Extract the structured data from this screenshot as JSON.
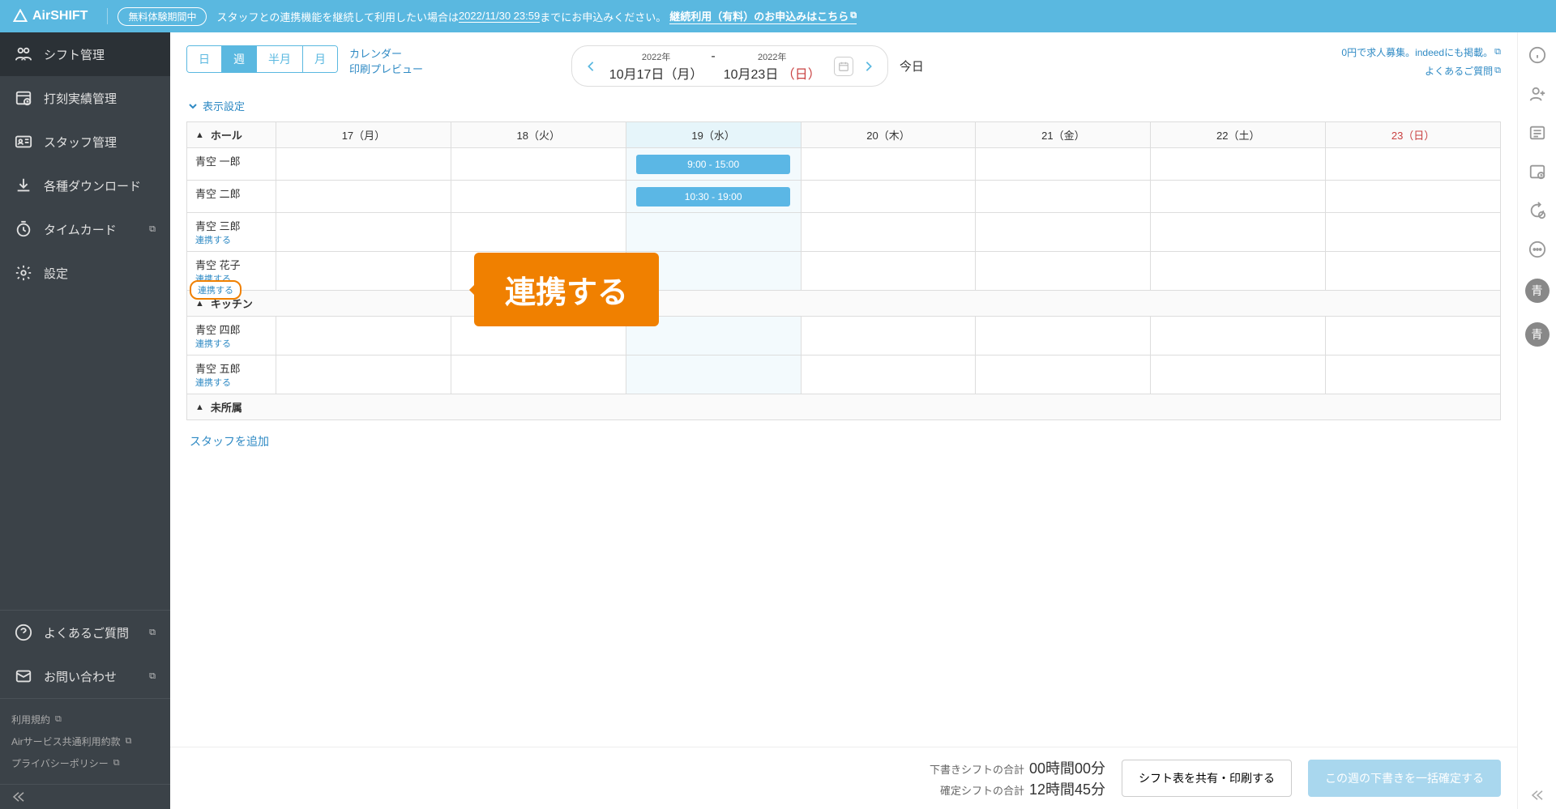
{
  "banner": {
    "logo_name": "AirSHIFT",
    "trial_badge": "無料体験期間中",
    "text_before": "スタッフとの連携機能を継続して利用したい場合は",
    "deadline": "2022/11/30 23:59",
    "text_after": "までにお申込みください。",
    "link_text": "継続利用（有料）のお申込みはこちら"
  },
  "sidebar": {
    "items": [
      {
        "label": "シフト管理",
        "icon": "users-list-icon",
        "active": true
      },
      {
        "label": "打刻実績管理",
        "icon": "clock-check-icon"
      },
      {
        "label": "スタッフ管理",
        "icon": "id-card-icon"
      },
      {
        "label": "各種ダウンロード",
        "icon": "download-icon"
      },
      {
        "label": "タイムカード",
        "icon": "timer-icon",
        "external": true
      },
      {
        "label": "設定",
        "icon": "gear-icon"
      }
    ],
    "lower": [
      {
        "label": "よくあるご質問",
        "icon": "help-circle-icon",
        "external": true
      },
      {
        "label": "お問い合わせ",
        "icon": "mail-icon",
        "external": true
      }
    ],
    "links": [
      {
        "label": "利用規約"
      },
      {
        "label": "Airサービス共通利用約款"
      },
      {
        "label": "プライバシーポリシー"
      }
    ]
  },
  "toolbar": {
    "segments": [
      "日",
      "週",
      "半月",
      "月"
    ],
    "active_segment": 1,
    "calendar_link": "カレンダー",
    "print_link": "印刷プレビュー",
    "date_from_year": "2022年",
    "date_from": "10月17日（月）",
    "date_to_year": "2022年",
    "date_to_prefix": "10月23日",
    "date_to_dow": "（日）",
    "today_label": "今日",
    "promo_link": "0円で求人募集。indeedにも掲載。",
    "faq_link": "よくあるご質問",
    "display_settings": "表示設定"
  },
  "calendar": {
    "days": [
      {
        "label": "17（月）"
      },
      {
        "label": "18（火）"
      },
      {
        "label": "19（水）",
        "today": true
      },
      {
        "label": "20（木）"
      },
      {
        "label": "21（金）"
      },
      {
        "label": "22（土）"
      },
      {
        "label": "23（日）",
        "sun": true
      }
    ],
    "groups": [
      {
        "name": "ホール",
        "rows": [
          {
            "name": "青空 一郎",
            "shifts": [
              null,
              null,
              "9:00 - 15:00",
              null,
              null,
              null,
              null
            ]
          },
          {
            "name": "青空 二郎",
            "shifts": [
              null,
              null,
              "10:30 - 19:00",
              null,
              null,
              null,
              null
            ]
          },
          {
            "name": "青空 三郎",
            "link": "連携する",
            "shifts": [
              null,
              null,
              null,
              null,
              null,
              null,
              null
            ]
          },
          {
            "name": "青空 花子",
            "link": "連携する",
            "shifts": [
              null,
              null,
              null,
              null,
              null,
              null,
              null
            ]
          }
        ]
      },
      {
        "name": "キッチン",
        "rows": [
          {
            "name": "青空 四郎",
            "link": "連携する",
            "shifts": [
              null,
              null,
              null,
              null,
              null,
              null,
              null
            ]
          },
          {
            "name": "青空 五郎",
            "link": "連携する",
            "shifts": [
              null,
              null,
              null,
              null,
              null,
              null,
              null
            ]
          }
        ]
      },
      {
        "name": "未所属",
        "rows": []
      }
    ],
    "add_staff": "スタッフを追加",
    "link_action_label": "連携する"
  },
  "callout": {
    "pill": "連携する",
    "text": "連携する"
  },
  "footer": {
    "draft_label": "下書きシフトの合計",
    "draft_value": "00時間00分",
    "confirmed_label": "確定シフトの合計",
    "confirmed_value": "12時間45分",
    "share_btn": "シフト表を共有・印刷する",
    "confirm_btn": "この週の下書きを一括確定する"
  },
  "rail": {
    "avatar_text": "青"
  }
}
